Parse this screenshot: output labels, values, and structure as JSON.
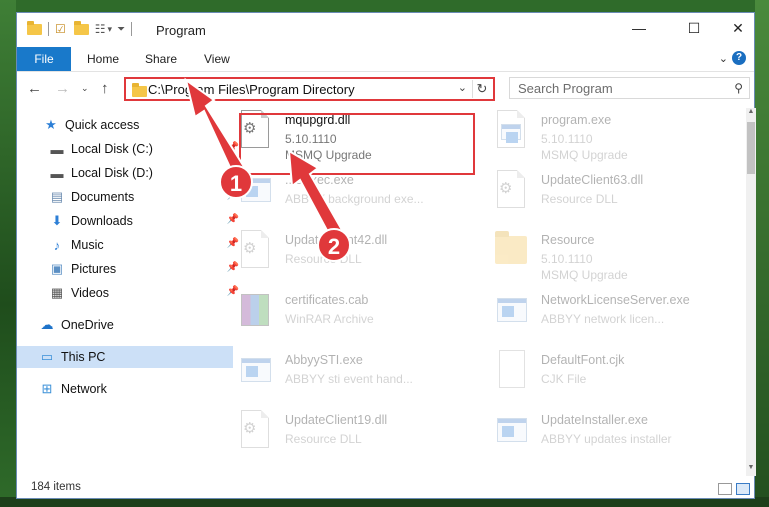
{
  "window": {
    "title": "Program",
    "minimize": "—",
    "maximize": "☐",
    "close": "✕"
  },
  "ribbon": {
    "tabs": [
      "File",
      "Home",
      "Share",
      "View"
    ],
    "help": "?"
  },
  "address": {
    "path": "C:\\Program Files\\Program Directory",
    "search_placeholder": "Search Program"
  },
  "nav": {
    "quick_access": "Quick access",
    "items": [
      {
        "label": "Local Disk (C:)",
        "icon": "drive-icon"
      },
      {
        "label": "Local Disk (D:)",
        "icon": "drive-icon"
      },
      {
        "label": "Documents",
        "icon": "documents-icon"
      },
      {
        "label": "Downloads",
        "icon": "downloads-icon"
      },
      {
        "label": "Music",
        "icon": "music-icon"
      },
      {
        "label": "Pictures",
        "icon": "pictures-icon"
      },
      {
        "label": "Videos",
        "icon": "videos-icon"
      }
    ],
    "onedrive": "OneDrive",
    "this_pc": "This PC",
    "network": "Network"
  },
  "files": [
    {
      "name": "mqupgrd.dll",
      "line2": "5.10.1110",
      "line3": "MSMQ Upgrade",
      "icon": "dll-gear-icon",
      "faded": false
    },
    {
      "name": "program.exe",
      "line2": "5.10.1110",
      "line3": "MSMQ Upgrade",
      "icon": "exe-icon",
      "faded": true
    },
    {
      "name": "...eExec.exe",
      "line2": "ABBYY background exe...",
      "line3": "",
      "icon": "exe-window-icon",
      "faded": true
    },
    {
      "name": "UpdateClient63.dll",
      "line2": "Resource DLL",
      "line3": "",
      "icon": "dll-gear-icon",
      "faded": true
    },
    {
      "name": "UpdateClient42.dll",
      "line2": "Resource DLL",
      "line3": "",
      "icon": "dll-gear-icon",
      "faded": true
    },
    {
      "name": "Resource",
      "line2": "5.10.1110",
      "line3": "MSMQ Upgrade",
      "icon": "folder-icon",
      "faded": true
    },
    {
      "name": "certificates.cab",
      "line2": "WinRAR Archive",
      "line3": "",
      "icon": "winrar-icon",
      "faded": true
    },
    {
      "name": "NetworkLicenseServer.exe",
      "line2": "ABBYY network licen...",
      "line3": "",
      "icon": "exe-window-icon",
      "faded": true
    },
    {
      "name": "AbbyySTI.exe",
      "line2": "ABBYY sti event hand...",
      "line3": "",
      "icon": "exe-window-icon",
      "faded": true
    },
    {
      "name": "DefaultFont.cjk",
      "line2": "CJK File",
      "line3": "",
      "icon": "blank-file-icon",
      "faded": true
    },
    {
      "name": "UpdateClient19.dll",
      "line2": "Resource DLL",
      "line3": "",
      "icon": "dll-gear-icon",
      "faded": true
    },
    {
      "name": "UpdateInstaller.exe",
      "line2": "ABBYY updates installer",
      "line3": "",
      "icon": "exe-window-icon",
      "faded": true
    }
  ],
  "status": {
    "items_count": "184 items"
  },
  "annotations": {
    "badge1": "1",
    "badge2": "2",
    "color": "#e0383b"
  }
}
